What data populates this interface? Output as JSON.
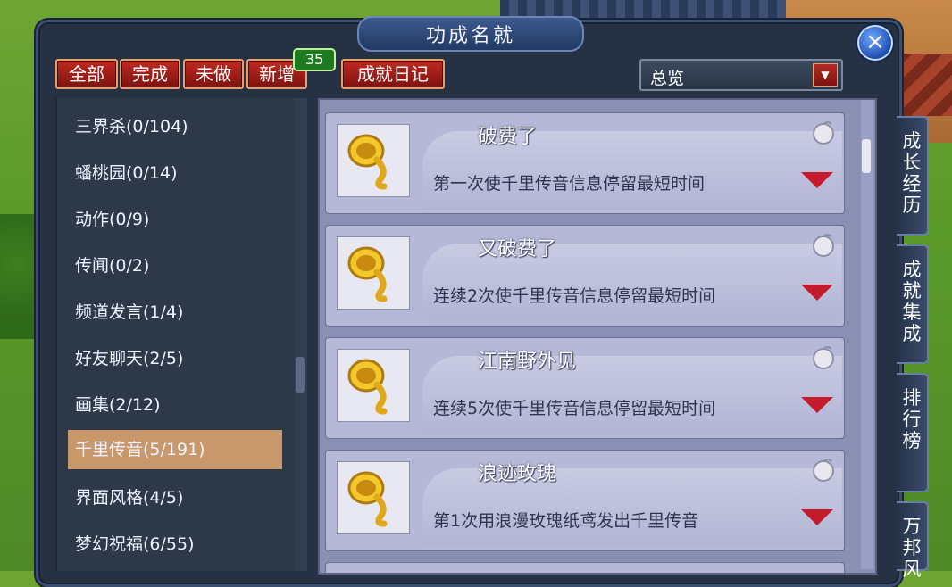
{
  "window": {
    "title": "功成名就",
    "close_icon": "close-icon"
  },
  "filters": {
    "all": "全部",
    "done": "完成",
    "undone": "未做",
    "new": "新增",
    "new_count": "35",
    "diary": "成就日记"
  },
  "dropdown": {
    "value": "总览"
  },
  "categories": [
    {
      "label": "三界杀(0/104)"
    },
    {
      "label": "蟠桃园(0/14)"
    },
    {
      "label": "动作(0/9)"
    },
    {
      "label": "传闻(0/2)"
    },
    {
      "label": "频道发言(1/4)"
    },
    {
      "label": "好友聊天(2/5)"
    },
    {
      "label": "画集(2/12)"
    },
    {
      "label": "千里传音(5/191)",
      "selected": true
    },
    {
      "label": "界面风格(4/5)"
    },
    {
      "label": "梦幻祝福(6/55)"
    }
  ],
  "achievements": [
    {
      "title": "破费了",
      "desc": "第一次使千里传音信息停留最短时间",
      "icon": "horn-icon"
    },
    {
      "title": "又破费了",
      "desc": "连续2次使千里传音信息停留最短时间",
      "icon": "horn-icon"
    },
    {
      "title": "江南野外见",
      "desc": "连续5次使千里传音信息停留最短时间",
      "icon": "horn-icon"
    },
    {
      "title": "浪迹玫瑰",
      "desc": "第1次用浪漫玫瑰纸鸢发出千里传音",
      "icon": "horn-icon"
    }
  ],
  "side_tabs": [
    {
      "label": "成长经历"
    },
    {
      "label": "成就集成"
    },
    {
      "label": "排行榜"
    },
    {
      "label": "万邦风"
    }
  ]
}
